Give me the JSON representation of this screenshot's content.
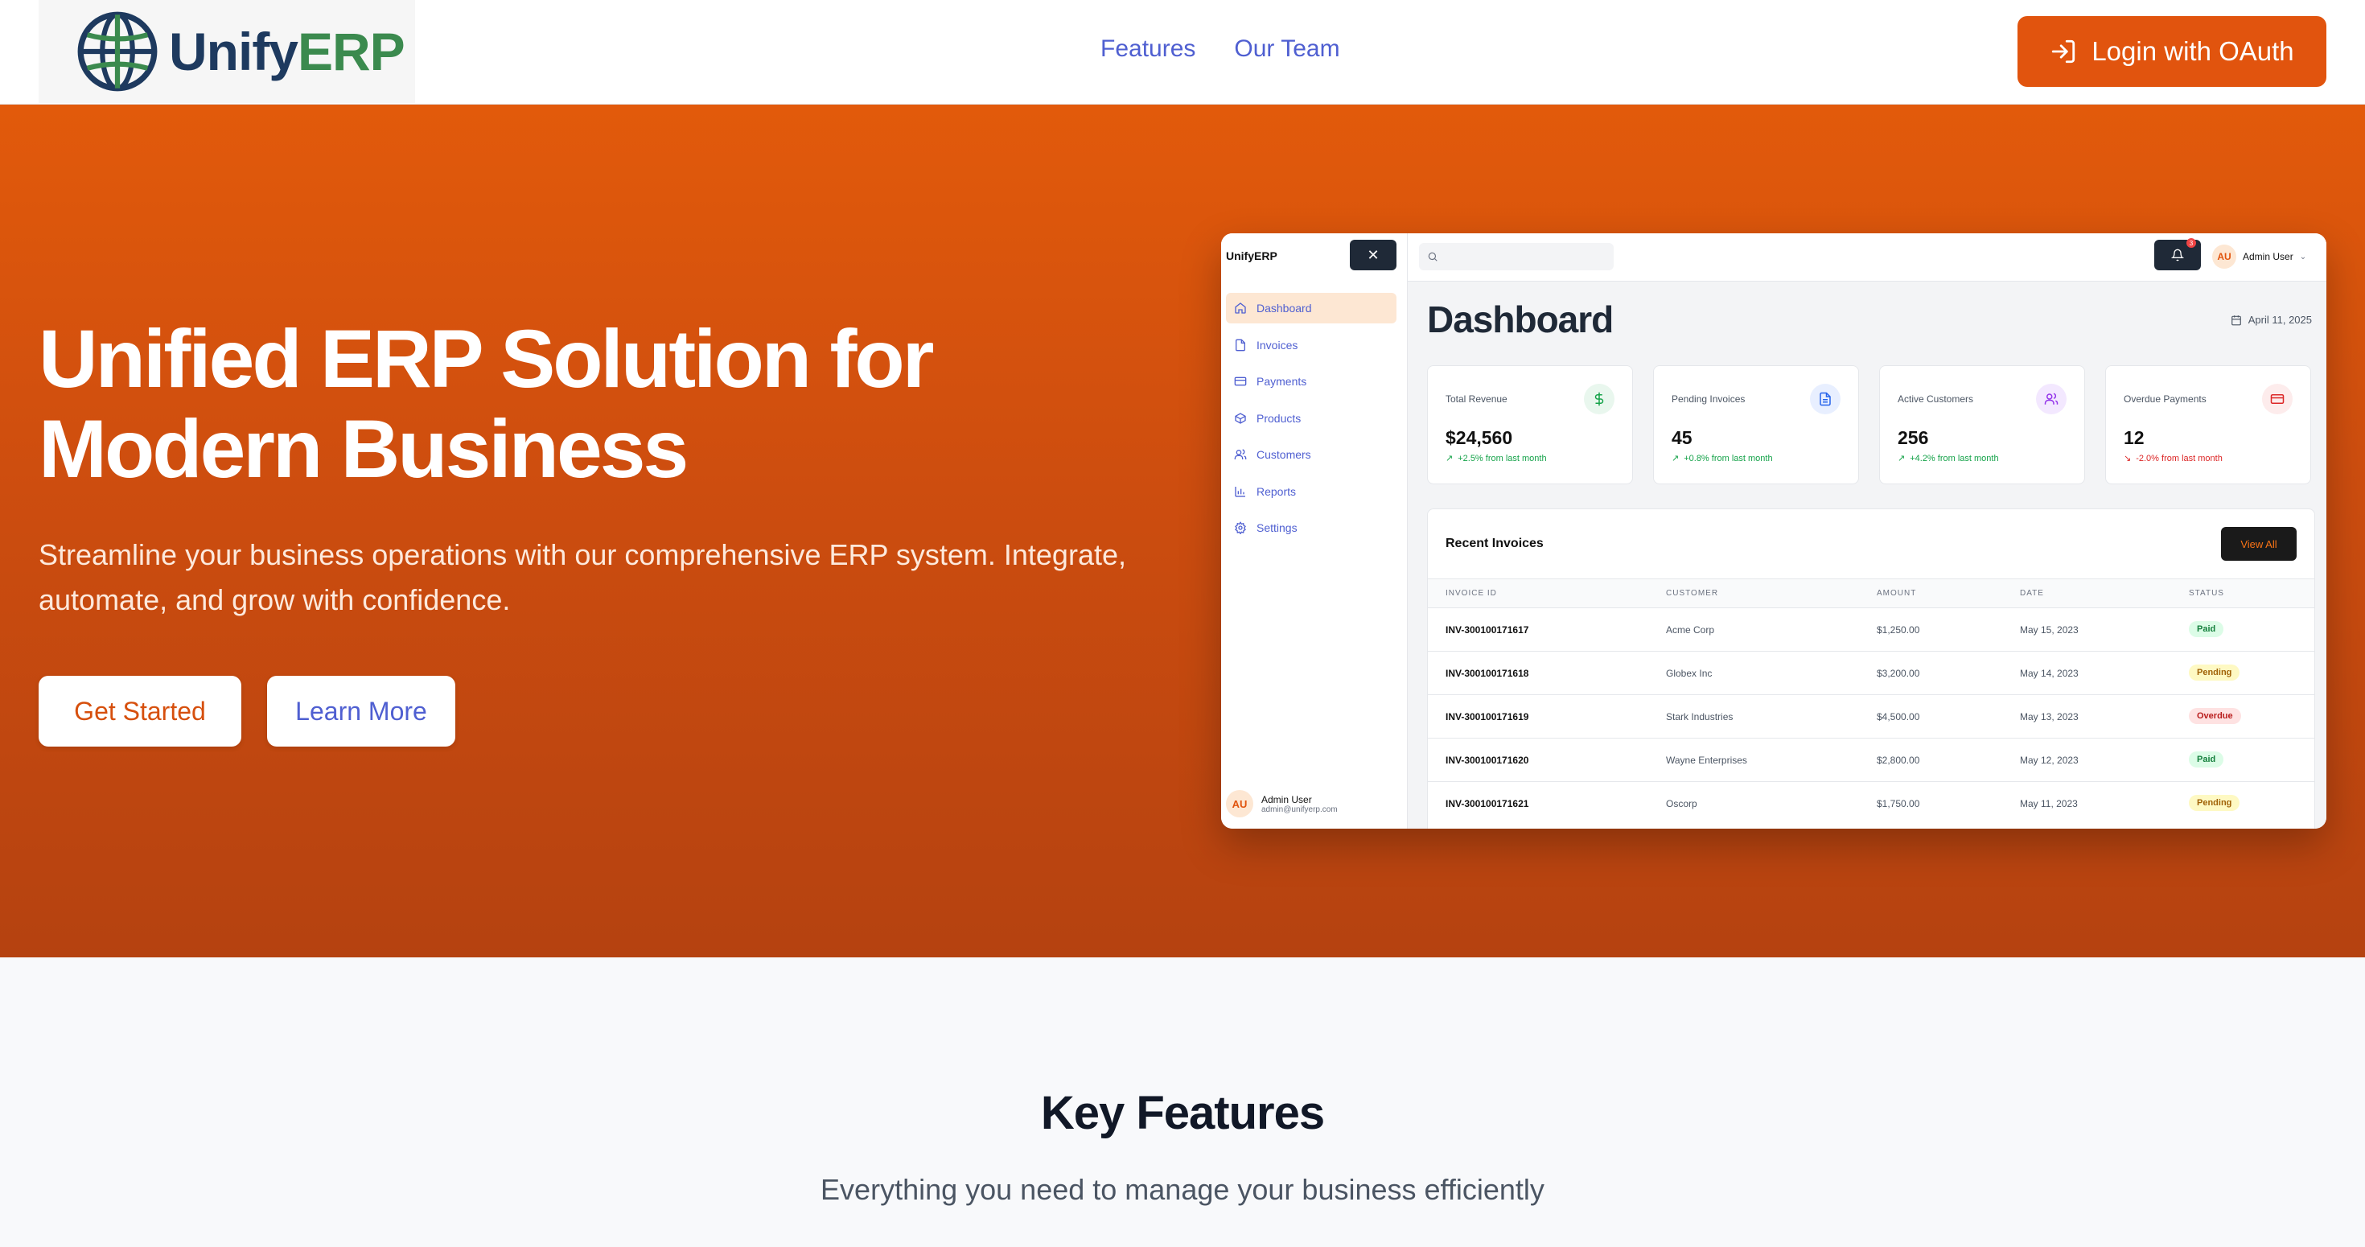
{
  "header": {
    "brand_part1": "Unify",
    "brand_part2": "ERP",
    "nav": [
      {
        "label": "Features"
      },
      {
        "label": "Our Team"
      }
    ],
    "login_label": "Login with OAuth"
  },
  "hero": {
    "title": "Unified ERP Solution for Modern Business",
    "subtitle": "Streamline your business operations with our comprehensive ERP system. Integrate, automate, and grow with confidence.",
    "primary_cta": "Get Started",
    "secondary_cta": "Learn More"
  },
  "mockup": {
    "brand": "UnifyERP",
    "menu": [
      {
        "label": "Dashboard",
        "icon": "home-icon"
      },
      {
        "label": "Invoices",
        "icon": "file-icon"
      },
      {
        "label": "Payments",
        "icon": "credit-card-icon"
      },
      {
        "label": "Products",
        "icon": "box-icon"
      },
      {
        "label": "Customers",
        "icon": "users-icon"
      },
      {
        "label": "Reports",
        "icon": "bar-chart-icon"
      },
      {
        "label": "Settings",
        "icon": "gear-icon"
      }
    ],
    "sidebar_user": {
      "initials": "AU",
      "name": "Admin User",
      "email": "admin@unifyerp.com"
    },
    "notification_count": "3",
    "top_user": {
      "initials": "AU",
      "name": "Admin User"
    },
    "page_title": "Dashboard",
    "date": "April 11, 2025",
    "stats": [
      {
        "label": "Total Revenue",
        "value": "$24,560",
        "change": "+2.5% from last month",
        "trend": "up",
        "icon": "dollar-icon",
        "color": "#16a34a",
        "bg": "#e9f7ee"
      },
      {
        "label": "Pending Invoices",
        "value": "45",
        "change": "+0.8% from last month",
        "trend": "up",
        "icon": "document-icon",
        "color": "#2563eb",
        "bg": "#e8efff"
      },
      {
        "label": "Active Customers",
        "value": "256",
        "change": "+4.2% from last month",
        "trend": "up",
        "icon": "users-icon",
        "color": "#9333ea",
        "bg": "#f3e8ff"
      },
      {
        "label": "Overdue Payments",
        "value": "12",
        "change": "-2.0% from last month",
        "trend": "down",
        "icon": "credit-card-icon",
        "color": "#dc2626",
        "bg": "#fdecec"
      }
    ],
    "recent_invoices": {
      "title": "Recent Invoices",
      "view_all": "View All",
      "columns": [
        "INVOICE ID",
        "CUSTOMER",
        "AMOUNT",
        "DATE",
        "STATUS"
      ],
      "rows": [
        {
          "id": "INV-300100171617",
          "customer": "Acme Corp",
          "amount": "$1,250.00",
          "date": "May 15, 2023",
          "status": "Paid"
        },
        {
          "id": "INV-300100171618",
          "customer": "Globex Inc",
          "amount": "$3,200.00",
          "date": "May 14, 2023",
          "status": "Pending"
        },
        {
          "id": "INV-300100171619",
          "customer": "Stark Industries",
          "amount": "$4,500.00",
          "date": "May 13, 2023",
          "status": "Overdue"
        },
        {
          "id": "INV-300100171620",
          "customer": "Wayne Enterprises",
          "amount": "$2,800.00",
          "date": "May 12, 2023",
          "status": "Paid"
        },
        {
          "id": "INV-300100171621",
          "customer": "Oscorp",
          "amount": "$1,750.00",
          "date": "May 11, 2023",
          "status": "Pending"
        }
      ]
    }
  },
  "features": {
    "title": "Key Features",
    "subtitle": "Everything you need to manage your business efficiently"
  },
  "colors": {
    "accent": "#e1540e",
    "nav_link": "#4f5fd1",
    "brand_dark": "#1e3a5f",
    "brand_green": "#3b8a4e"
  }
}
